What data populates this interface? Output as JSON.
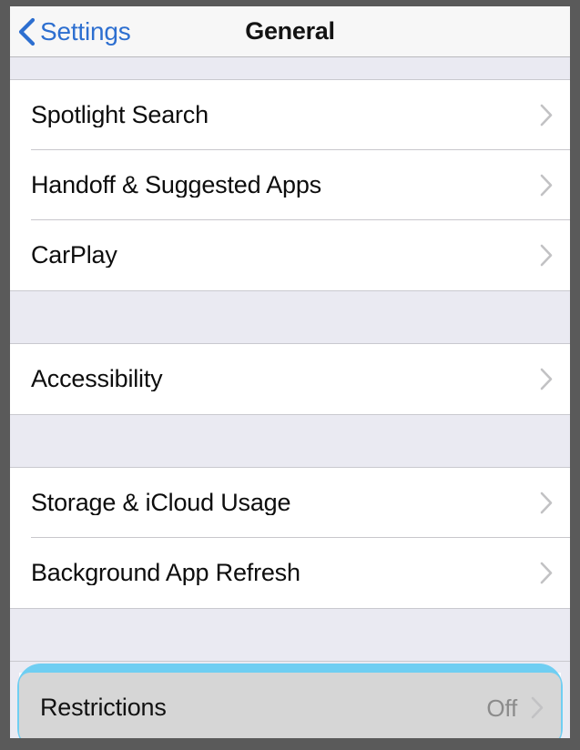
{
  "window": {
    "frame_color": "#5a5a5a",
    "screen_background": "#eaeaf2"
  },
  "navbar": {
    "back_label": "Settings",
    "back_icon": "chevron-left-icon",
    "title": "General",
    "tint_color": "#2d6fd0",
    "background": "#f7f7f7"
  },
  "annotation": {
    "target_row": "Restrictions",
    "ring_color": "#6fcef2",
    "shape": "rounded-rectangle"
  },
  "sections": [
    {
      "id": "section-discovery",
      "rows": [
        {
          "label": "Spotlight Search",
          "value": "",
          "accessory": "chevron-right-icon",
          "selected": false
        },
        {
          "label": "Handoff & Suggested Apps",
          "value": "",
          "accessory": "chevron-right-icon",
          "selected": false
        },
        {
          "label": "CarPlay",
          "value": "",
          "accessory": "chevron-right-icon",
          "selected": false
        }
      ]
    },
    {
      "id": "section-accessibility",
      "rows": [
        {
          "label": "Accessibility",
          "value": "",
          "accessory": "chevron-right-icon",
          "selected": false
        }
      ]
    },
    {
      "id": "section-storage",
      "rows": [
        {
          "label": "Storage & iCloud Usage",
          "value": "",
          "accessory": "chevron-right-icon",
          "selected": false
        },
        {
          "label": "Background App Refresh",
          "value": "",
          "accessory": "chevron-right-icon",
          "selected": false
        }
      ]
    },
    {
      "id": "section-restrictions",
      "highlighted": true,
      "rows": [
        {
          "label": "Restrictions",
          "value": "Off",
          "accessory": "chevron-right-icon",
          "selected": true
        }
      ]
    }
  ]
}
